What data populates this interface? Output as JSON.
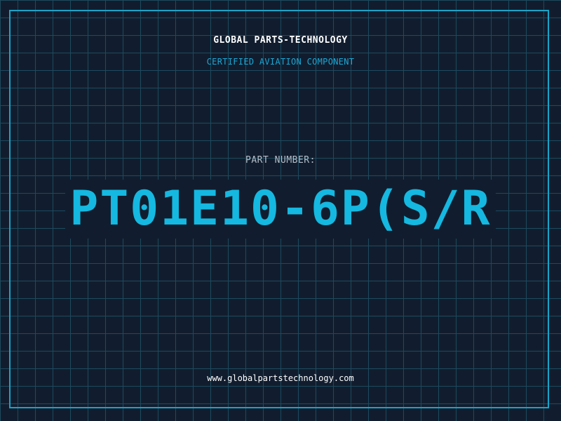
{
  "header": {
    "company": "GLOBAL PARTS-TECHNOLOGY",
    "tagline": "CERTIFIED AVIATION COMPONENT"
  },
  "part": {
    "label": "PART NUMBER:",
    "number": "PT01E10-6P(S/R"
  },
  "footer": {
    "website": "www.globalpartstechnology.com"
  },
  "colors": {
    "background": "#111d2e",
    "grid": "#1d4a5e",
    "frame": "#1aa3c8",
    "accent": "#15b8e0",
    "text": "#ffffff"
  }
}
